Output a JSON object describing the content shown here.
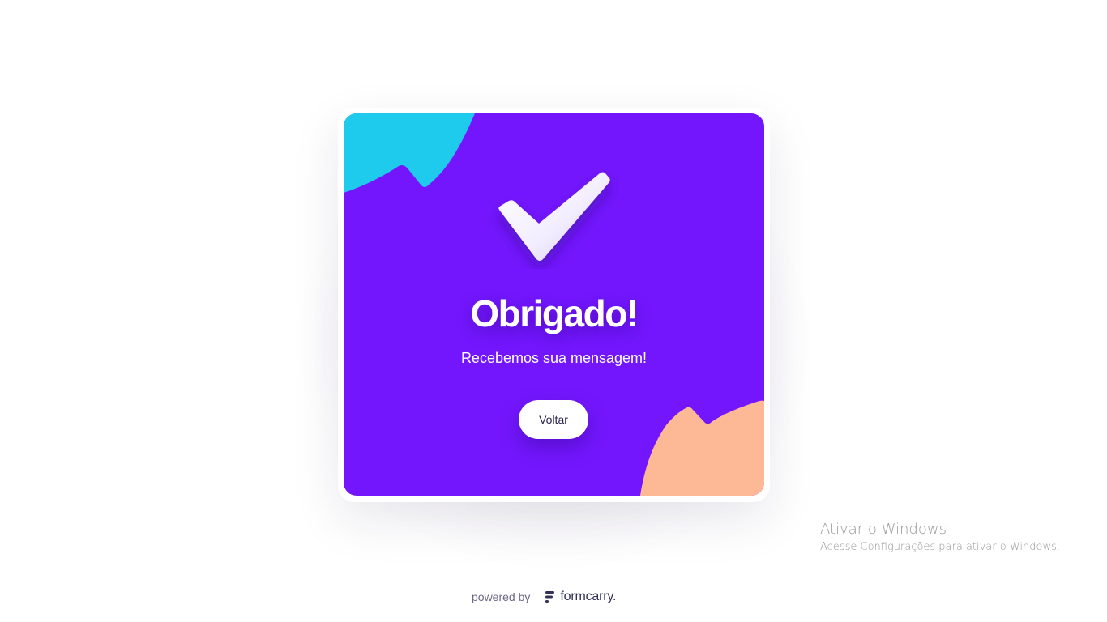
{
  "card": {
    "title": "Obrigado!",
    "message": "Recebemos sua mensagem!",
    "button_label": "Voltar",
    "check_icon": "check-icon"
  },
  "footer": {
    "powered_by": "powered by",
    "brand_name": "formcarry."
  },
  "windows_watermark": {
    "title": "Ativar o Windows",
    "subtitle": "Acesse Configurações para ativar o Windows."
  },
  "colors": {
    "card_background": "#7316fd",
    "blob_top_left": "#1ecbec",
    "blob_bottom_right": "#fdb996",
    "button_background": "#ffffff",
    "button_text": "#2b2350"
  }
}
